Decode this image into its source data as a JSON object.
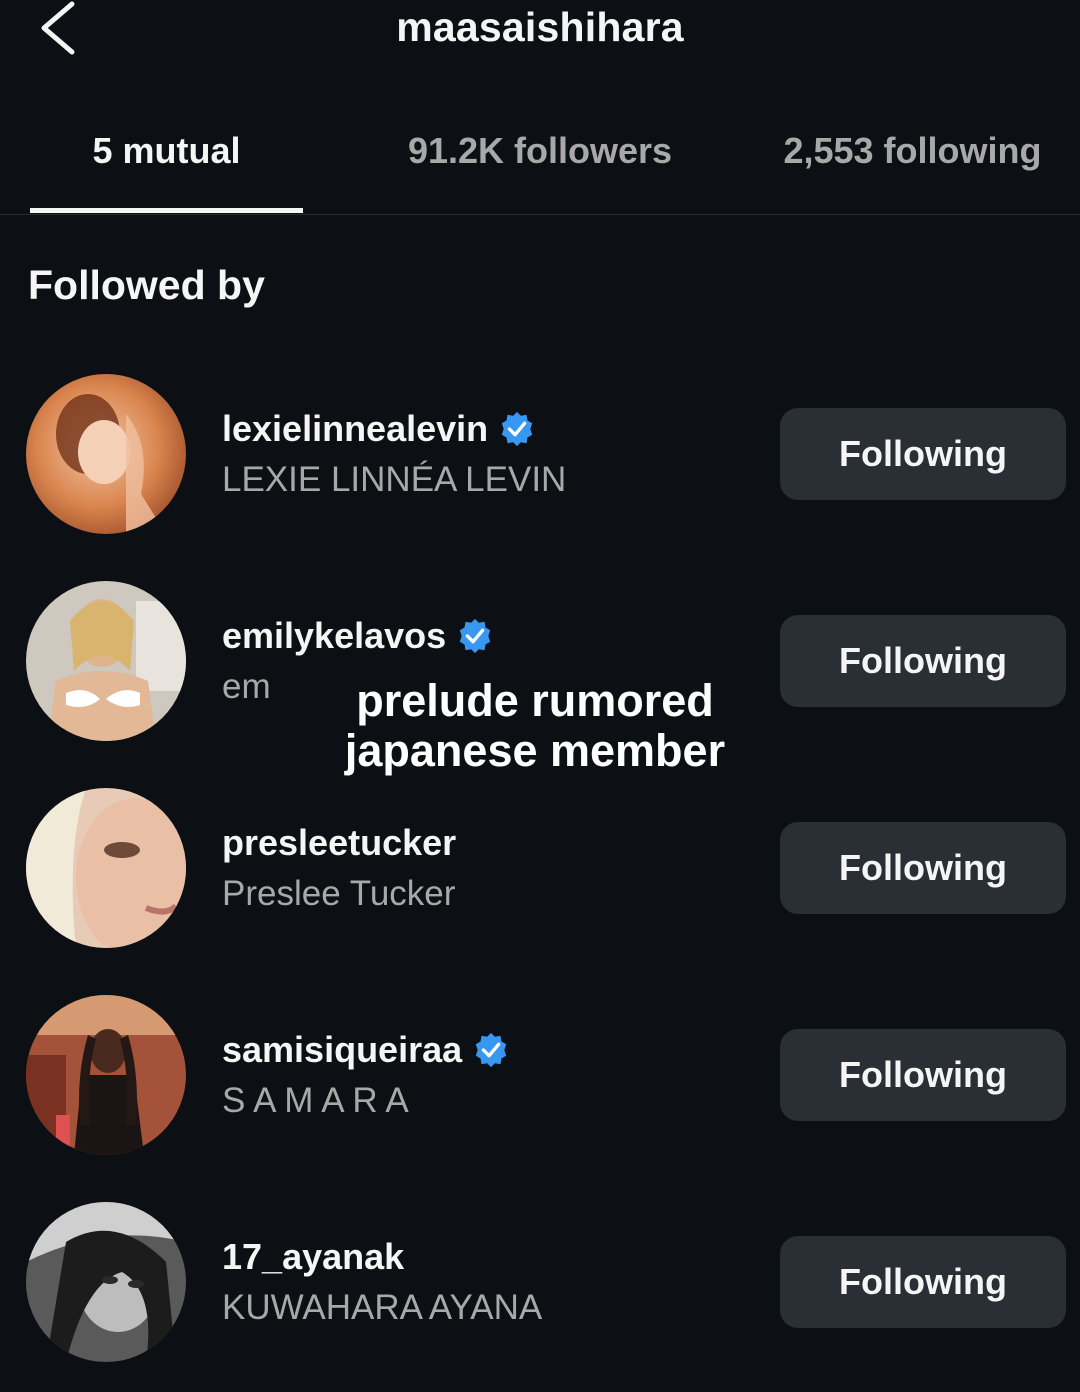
{
  "header": {
    "title": "maasaishihara"
  },
  "tabs": [
    {
      "label": "5 mutual",
      "active": true
    },
    {
      "label": "91.2K followers",
      "active": false
    },
    {
      "label": "2,553 following",
      "active": false
    }
  ],
  "section": {
    "title": "Followed by"
  },
  "users": [
    {
      "username": "lexielinnealevin",
      "fullname": "LEXIE LINNÉA LEVIN",
      "verified": true,
      "button": "Following",
      "avatar_icon": "avatar-photo"
    },
    {
      "username": "emilykelavos",
      "fullname": "em",
      "verified": true,
      "button": "Following",
      "avatar_icon": "avatar-photo"
    },
    {
      "username": "presleetucker",
      "fullname": "Preslee Tucker",
      "verified": false,
      "button": "Following",
      "avatar_icon": "avatar-photo"
    },
    {
      "username": "samisiqueiraa",
      "fullname": "S A M A R A",
      "verified": true,
      "button": "Following",
      "avatar_icon": "avatar-photo"
    },
    {
      "username": "17_ayanak",
      "fullname": "KUWAHARA AYANA",
      "verified": false,
      "button": "Following",
      "avatar_icon": "avatar-photo"
    }
  ],
  "overlay_caption": {
    "line1": "prelude rumored",
    "line2": "japanese member"
  },
  "colors": {
    "background": "#0c1014",
    "button": "#2a2f35",
    "verified": "#3897f0",
    "secondary_text": "#a8a8a8"
  },
  "icons": {
    "back": "chevron-left-icon",
    "verified": "verified-badge-icon"
  }
}
